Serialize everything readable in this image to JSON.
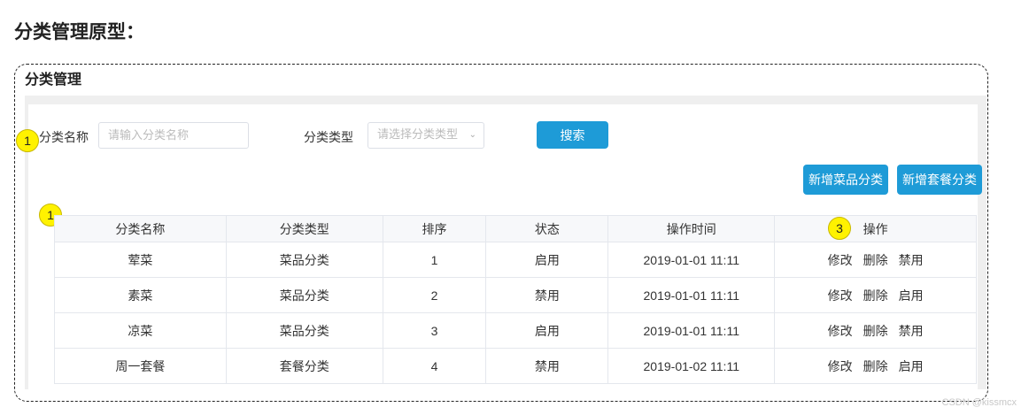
{
  "heading": "分类管理原型：",
  "panel_title": "分类管理",
  "badges": [
    "1",
    "1",
    "3"
  ],
  "filters": {
    "name_label": "分类名称",
    "name_placeholder": "请输入分类名称",
    "type_label": "分类类型",
    "type_placeholder": "请选择分类类型",
    "search_label": "搜索"
  },
  "actions": {
    "add_dish_category": "新增菜品分类",
    "add_setmeal_category": "新增套餐分类"
  },
  "table": {
    "headers": [
      "分类名称",
      "分类类型",
      "排序",
      "状态",
      "操作时间",
      "操作"
    ],
    "rows": [
      {
        "name": "荤菜",
        "type": "菜品分类",
        "sort": "1",
        "status": "启用",
        "time": "2019-01-01 11:11",
        "ops": [
          "修改",
          "删除",
          "禁用"
        ]
      },
      {
        "name": "素菜",
        "type": "菜品分类",
        "sort": "2",
        "status": "禁用",
        "time": "2019-01-01 11:11",
        "ops": [
          "修改",
          "删除",
          "启用"
        ]
      },
      {
        "name": "凉菜",
        "type": "菜品分类",
        "sort": "3",
        "status": "启用",
        "time": "2019-01-01 11:11",
        "ops": [
          "修改",
          "删除",
          "禁用"
        ]
      },
      {
        "name": "周一套餐",
        "type": "套餐分类",
        "sort": "4",
        "status": "禁用",
        "time": "2019-01-02 11:11",
        "ops": [
          "修改",
          "删除",
          "启用"
        ]
      }
    ]
  },
  "watermark": "CSDN @kissmcx",
  "colors": {
    "accent": "#1e9bd7",
    "badge": "#fff200"
  }
}
